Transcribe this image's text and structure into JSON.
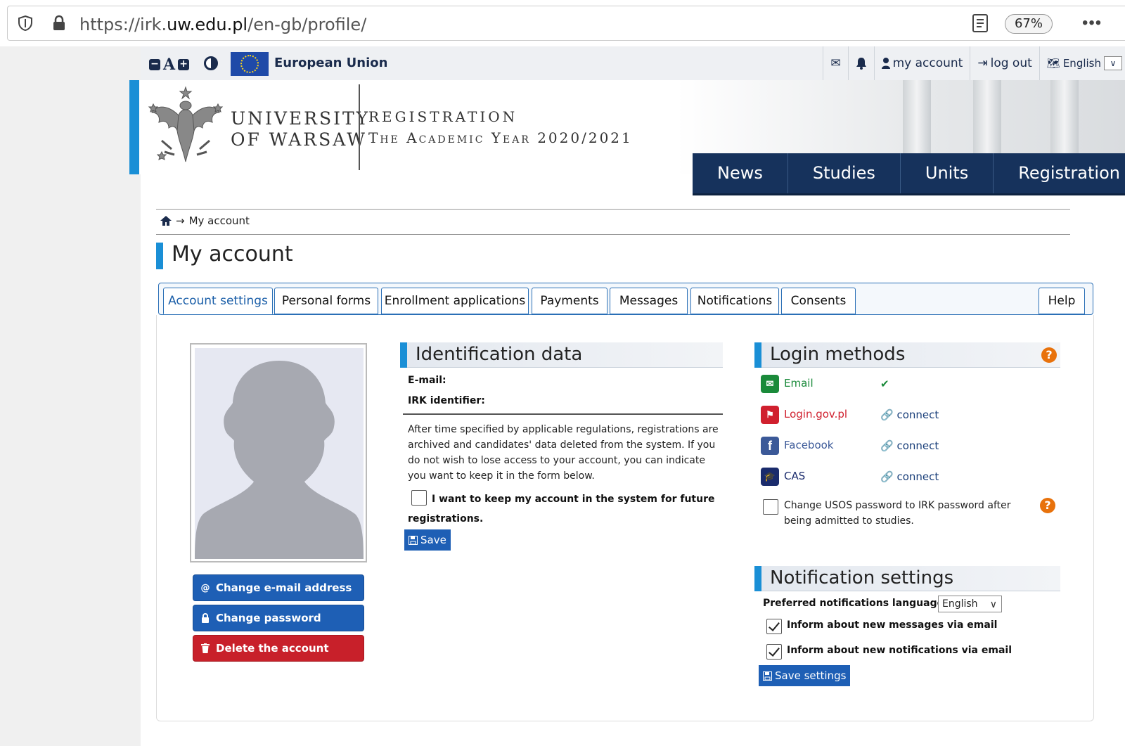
{
  "browser": {
    "url_prefix": "https://irk.",
    "url_domain": "uw.edu.pl",
    "url_path": "/en-gb/profile/",
    "zoom": "67%"
  },
  "topbar": {
    "eu_label": "European Union",
    "my_account": "my account",
    "log_out": "log out",
    "language": "English"
  },
  "header": {
    "uni_line1": "UNIVERSITY",
    "uni_line2": "OF WARSAW",
    "reg_title": "REGISTRATION",
    "reg_year": "The Academic Year 2020/2021"
  },
  "nav": [
    "News",
    "Studies",
    "Units",
    "Registration"
  ],
  "breadcrumb": {
    "arrow": "→",
    "current": "My account"
  },
  "page_title": "My account",
  "tabs": {
    "account_settings": "Account settings",
    "personal_forms": "Personal forms",
    "enrollment_applications": "Enrollment applications",
    "payments": "Payments",
    "messages": "Messages",
    "notifications": "Notifications",
    "consents": "Consents",
    "help": "Help"
  },
  "side_buttons": {
    "change_email": "Change e-mail address",
    "change_password": "Change password",
    "delete_account": "Delete the account"
  },
  "identification": {
    "title": "Identification data",
    "email_label": "E-mail:",
    "irk_label": "IRK identifier:",
    "notice": "After time specified by applicable regulations, registrations are archived and candidates' data deleted from the system. If you do not wish to lose access to your account, you can indicate you want to keep it in the form below.",
    "keep_label": "I want to keep my account in the system for future registrations.",
    "save": "Save"
  },
  "login_methods": {
    "title": "Login methods",
    "help": "?",
    "email": "Email",
    "email_status": "✔",
    "logingov": "Login.gov.pl",
    "facebook": "Facebook",
    "cas": "CAS",
    "connect": "connect",
    "usos_label": "Change USOS password to IRK password after being admitted to studies."
  },
  "notification_settings": {
    "title": "Notification settings",
    "pref_lang_label": "Preferred notifications language:",
    "pref_lang_value": "English",
    "inform_messages": "Inform about new messages via email",
    "inform_notifications": "Inform about new notifications via email",
    "save": "Save settings"
  },
  "colors": {
    "accent_blue": "#1a8fd6",
    "nav_navy": "#16325c",
    "button_blue": "#1e5fb5",
    "danger_red": "#c8202a",
    "help_orange": "#e8720c"
  }
}
